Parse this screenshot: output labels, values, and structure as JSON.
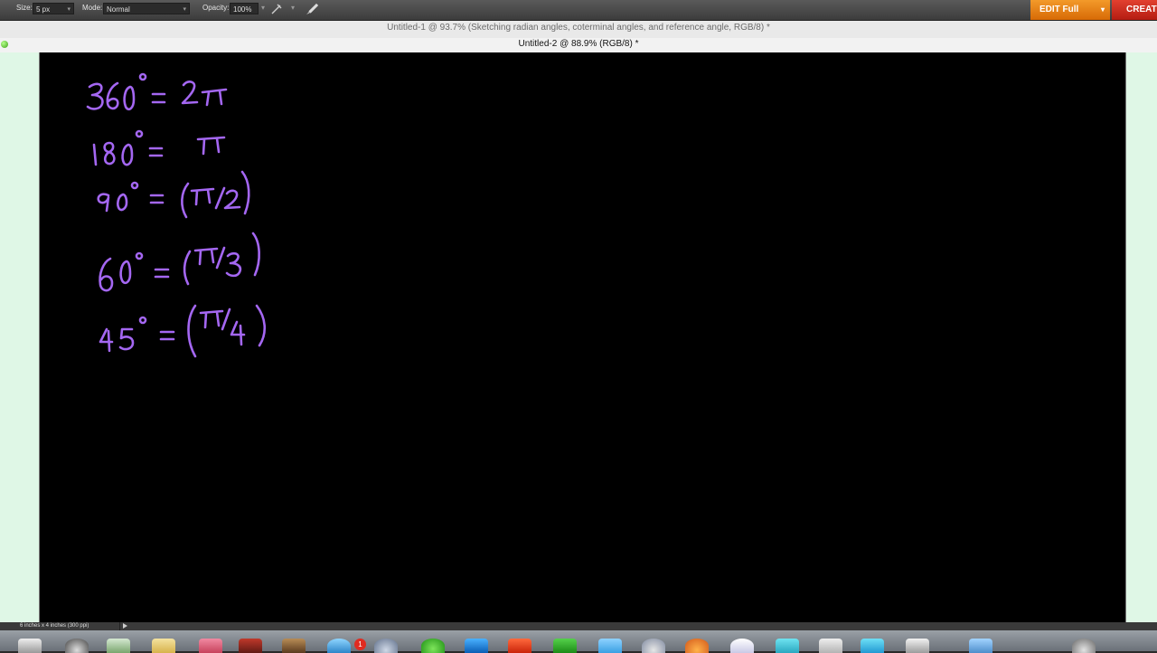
{
  "options_bar": {
    "size_label": "Size:",
    "size_value": "5 px",
    "mode_label": "Mode:",
    "mode_value": "Normal",
    "opacity_label": "Opacity:",
    "opacity_value": "100%",
    "edit_button": "EDIT Full",
    "create_button": "CREATE"
  },
  "tabs": {
    "inactive_title": "Untitled-1 @ 93.7% (Sketching radian angles, coterminal angles, and reference angle, RGB/8) *",
    "active_title": "Untitled-2 @ 88.9% (RGB/8) *"
  },
  "canvas": {
    "ink_color": "#a467f2",
    "equations": [
      {
        "degrees": "360",
        "radians": "2π"
      },
      {
        "degrees": "180",
        "radians": "π"
      },
      {
        "degrees": "90",
        "radians": "(π/2)"
      },
      {
        "degrees": "60",
        "radians": "(π/3)"
      },
      {
        "degrees": "45",
        "radians": "(π/4)"
      }
    ]
  },
  "status_bar": {
    "doc_size": "6 inches x 4 inches (300 ppi)"
  },
  "dock": {
    "badge_count": "1"
  }
}
